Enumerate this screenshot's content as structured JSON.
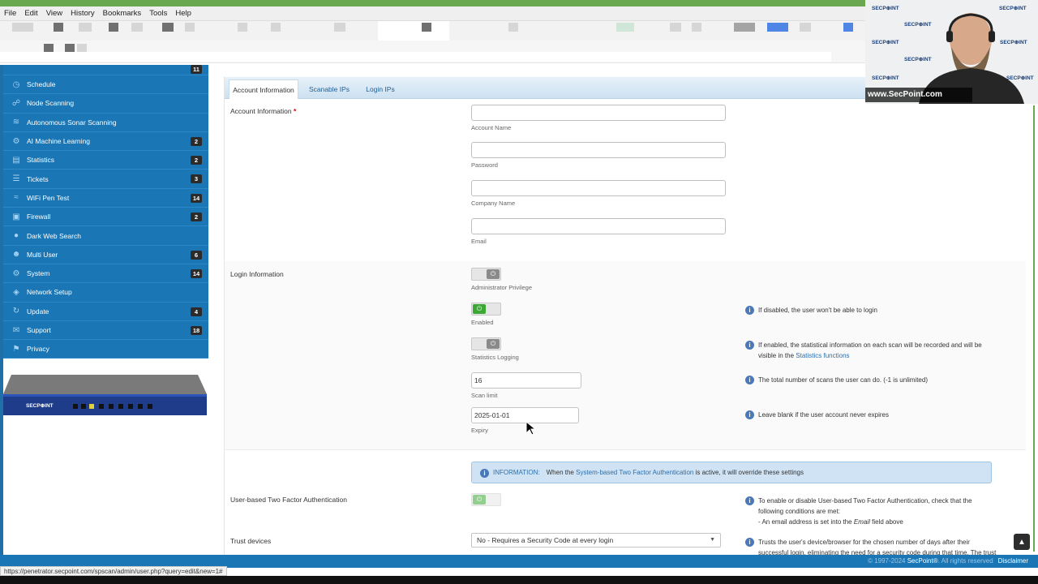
{
  "browser": {
    "menu": [
      "File",
      "Edit",
      "View",
      "History",
      "Bookmarks",
      "Tools",
      "Help"
    ]
  },
  "sidebar": {
    "items": [
      {
        "label": "",
        "icon": "dashboard-icon",
        "badge": ""
      },
      {
        "label": "Schedule",
        "icon": "clock-icon",
        "badge": ""
      },
      {
        "label": "Node Scanning",
        "icon": "node-icon",
        "badge": ""
      },
      {
        "label": "Autonomous Sonar Scanning",
        "icon": "sonar-icon",
        "badge": ""
      },
      {
        "label": "AI Machine Learning",
        "icon": "ai-icon",
        "badge": "2"
      },
      {
        "label": "Statistics",
        "icon": "bar-chart-icon",
        "badge": "2"
      },
      {
        "label": "Tickets",
        "icon": "ticket-icon",
        "badge": "3"
      },
      {
        "label": "WiFi Pen Test",
        "icon": "wifi-icon",
        "badge": "14"
      },
      {
        "label": "Firewall",
        "icon": "firewall-icon",
        "badge": "2"
      },
      {
        "label": "Dark Web Search",
        "icon": "dark-web-icon",
        "badge": ""
      },
      {
        "label": "Multi User",
        "icon": "users-icon",
        "badge": "6"
      },
      {
        "label": "System",
        "icon": "gear-icon",
        "badge": "14"
      },
      {
        "label": "Network Setup",
        "icon": "network-icon",
        "badge": ""
      },
      {
        "label": "Update",
        "icon": "update-icon",
        "badge": "4"
      },
      {
        "label": "Support",
        "icon": "support-icon",
        "badge": "18"
      },
      {
        "label": "Privacy",
        "icon": "lock-icon",
        "badge": ""
      }
    ],
    "device_brand": "SECP⊕INT"
  },
  "tabs": [
    {
      "label": "Account Information",
      "active": true
    },
    {
      "label": "Scanable IPs",
      "active": false
    },
    {
      "label": "Login IPs",
      "active": false
    }
  ],
  "account": {
    "section_label": "Account Information",
    "required_mark": "*",
    "fields": [
      {
        "label": "Account Name",
        "value": ""
      },
      {
        "label": "Password",
        "value": ""
      },
      {
        "label": "Company Name",
        "value": ""
      },
      {
        "label": "Email",
        "value": ""
      }
    ]
  },
  "login": {
    "section_label": "Login Information",
    "admin_label": "Administrator Privilege",
    "admin_on": false,
    "enabled_label": "Enabled",
    "enabled_on": true,
    "enabled_hint": "If disabled, the user won't be able to login",
    "stats_label": "Statistics Logging",
    "stats_on": false,
    "stats_hint": "If enabled, the statistical information on each scan will be recorded and will be",
    "stats_hint2_prefix": "visible in the",
    "stats_hint2_link": "Statistics functions",
    "scan_limit_value": "16",
    "scan_limit_label": "Scan limit",
    "scan_limit_hint": "The total number of scans the user can do. (-1 is unlimited)",
    "expiry_value": "2025-01-01",
    "expiry_label": "Expiry",
    "expiry_hint": "Leave blank if the user account never expires"
  },
  "twofa": {
    "banner_lead": "INFORMATION:",
    "banner_pre": "When the",
    "banner_link": "System-based Two Factor Authentication",
    "banner_post": "is active, it will override these settings",
    "user_label": "User-based Two Factor Authentication",
    "user_hint1": "To enable or disable User-based Two Factor Authentication, check that the",
    "user_hint2": "following conditions are met:",
    "user_hint3_pre": "- An email address is set into the",
    "user_hint3_em": "Email",
    "user_hint3_post": "field above",
    "trust_label": "Trust devices",
    "trust_value": "No - Requires a Security Code at every login",
    "trust_hint1": "Trusts the user's device/browser for the chosen number of days after their",
    "trust_hint2": "successful login, eliminating the need for a security code during that time. The trust"
  },
  "footer": {
    "copyright": "© 1997-2024",
    "brand": "SecPoint®",
    "rights": ". All rights reserved",
    "disclaimer": "Disclaimer"
  },
  "status_url": "https://penetrator.secpoint.com/spscan/admin/user.php?query=edit&new=1#",
  "webcam": {
    "url": "www.SecPoint.com",
    "watermark": "SECP⊕INT"
  },
  "colors": {
    "sidebar": "#1a76b4",
    "accent_green": "#6aa84f",
    "toggle_on": "#3aa832",
    "info_banner": "#cfe3f4"
  }
}
